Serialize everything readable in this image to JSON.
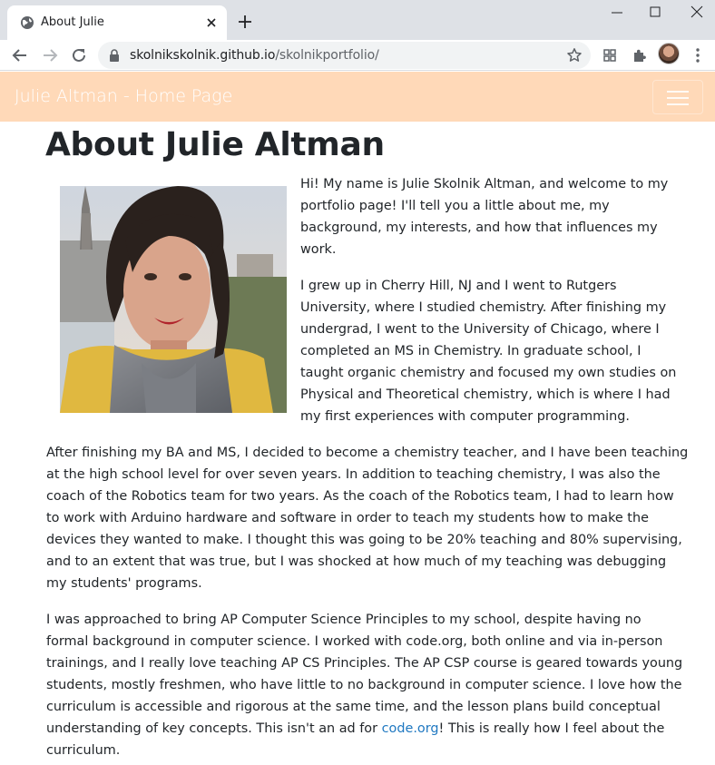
{
  "browser": {
    "tab_title": "About Julie",
    "url_host": "skolnikskolnik.github.io",
    "url_path": "/skolnikportfolio/"
  },
  "navbar": {
    "brand": "Julie Altman - Home Page"
  },
  "main": {
    "title": "About Julie Altman",
    "p1": [
      "Hi! My name is Julie Skolnik Altman, and welcome to my",
      "portfolio page! I'll tell you a little about me, my",
      "background, my interests, and how that influences my",
      "work."
    ],
    "p2": [
      "I grew up in Cherry Hill, NJ and I went to Rutgers",
      "University, where I studied chemistry. After finishing my",
      "undergrad, I went to the University of Chicago, where I",
      "completed an MS in Chemistry. In graduate school, I",
      "taught organic chemistry and focused my own studies on",
      "Physical and Theoretical chemistry, which is where I had",
      "my first experiences with computer programming."
    ],
    "p3": [
      "After finishing my BA and MS, I decided to become a chemistry teacher, and I have been teaching",
      "at the high school level for over seven years. In addition to teaching chemistry, I was also the",
      "coach of the Robotics team for two years. As the coach of the Robotics team, I had to learn how",
      "to work with Arduino hardware and software in order to teach my students how to make the",
      "devices they wanted to make. I thought this was going to be 20% teaching and 80% supervising,",
      "and to an extent that was true, but I was shocked at how much of my teaching was debugging",
      "my students' programs."
    ],
    "p4": [
      "I was approached to bring AP Computer Science Principles to my school, despite having no",
      "formal background in computer science. I worked with code.org, both online and via in-person",
      "trainings, and I really love teaching AP CS Principles. The AP CSP course is geared towards young",
      "students, mostly freshmen, who have little to no background in computer science. I love how the",
      "curriculum is accessible and rigorous at the same time, and the lesson plans build conceptual"
    ],
    "p4_link_before": "understanding of key concepts. This isn't an ad for ",
    "p4_link": "code.org",
    "p4_link_after": "! This is really how I feel about the",
    "p4_last": "curriculum."
  }
}
